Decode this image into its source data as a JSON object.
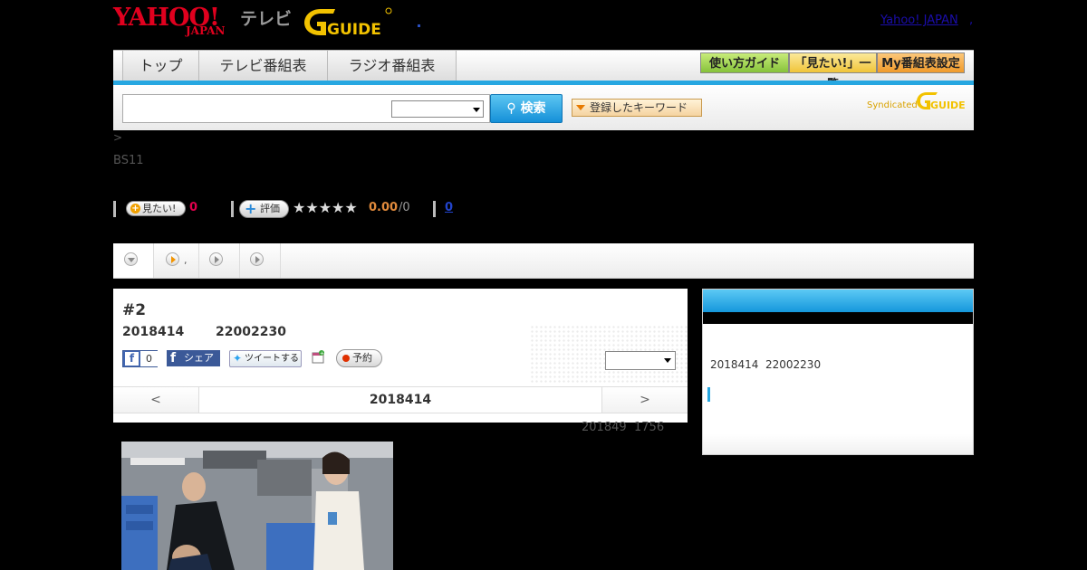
{
  "header": {
    "yahoo_logo": "YAHOO!",
    "yahoo_logo_sub": "JAPAN",
    "tv_label": "テレビ",
    "gguide_logo": "GUIDE",
    "yahoo_japan_link": "Yahoo! JAPAN",
    "link_separator": ","
  },
  "nav": {
    "tabs": [
      {
        "label": "トップ"
      },
      {
        "label": "テレビ番組表"
      },
      {
        "label": "ラジオ番組表"
      }
    ],
    "buttons": [
      {
        "label": "使い方ガイド",
        "color": "#9fd24a"
      },
      {
        "label": "「見たい!」一覧",
        "color": "#f5d35a"
      },
      {
        "label": "My番組表設定",
        "color": "#f5a742"
      }
    ]
  },
  "search": {
    "query": "",
    "select_value": "",
    "search_button": "検索",
    "keyword_button": "登録したキーワード",
    "syndicated_label": "Syndicated",
    "syndicated_logo": "GUIDE"
  },
  "breadcrumb": {
    "arrow": ">"
  },
  "program": {
    "channel": "BS11",
    "mitai_button": "見たい!",
    "mitai_count": "0",
    "rate_button": "評価",
    "stars": "★★★★★",
    "score": "0.00",
    "score_count": "/0",
    "comment_count": "0",
    "title": "#2",
    "date": "2018414",
    "time": "22002230",
    "fb_like_count": "0",
    "fb_share_label": "シェア",
    "tweet_label": "ツイートする",
    "reserve_label": "予約",
    "datenav_prev": "<",
    "datenav_current": "2018414",
    "datenav_next": ">",
    "updated_date": "201849",
    "updated_time": "1756"
  },
  "subtabs": [
    {
      "label": ""
    },
    {
      "label": ","
    },
    {
      "label": ""
    },
    {
      "label": ""
    }
  ],
  "sidebar": {
    "date": "2018414",
    "time": "22002230"
  },
  "colors": {
    "accent_blue": "#27a7e1",
    "yahoo_red": "#e0001e",
    "gguide_yellow": "#f2c200",
    "mitai_pink": "#e0004d",
    "score_orange": "#e08a3c"
  }
}
